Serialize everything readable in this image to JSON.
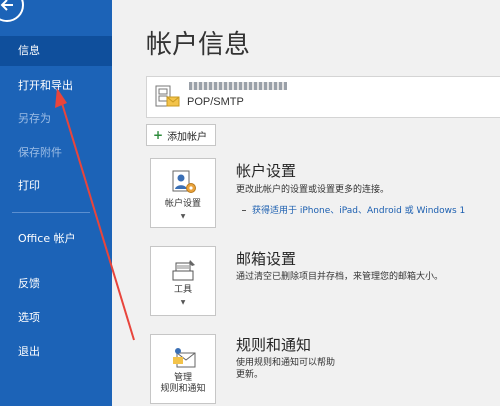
{
  "sidebar": {
    "items": [
      {
        "label": "信息",
        "state": "selected"
      },
      {
        "label": "打开和导出",
        "state": "normal"
      },
      {
        "label": "另存为",
        "state": "disabled"
      },
      {
        "label": "保存附件",
        "state": "disabled"
      },
      {
        "label": "打印",
        "state": "normal"
      },
      {
        "label": "Office 帐户",
        "state": "normal"
      },
      {
        "label": "反馈",
        "state": "normal"
      },
      {
        "label": "选项",
        "state": "normal"
      },
      {
        "label": "退出",
        "state": "normal"
      }
    ]
  },
  "main": {
    "title": "帐户信息",
    "account": {
      "type": "POP/SMTP"
    },
    "add_account_label": "添加帐户",
    "sections": [
      {
        "button_label": "帐户设置",
        "title": "帐户设置",
        "desc": "更改此帐户的设置或设置更多的连接。",
        "link": "获得适用于 iPhone、iPad、Android 或 Windows 1"
      },
      {
        "button_label": "工具",
        "title": "邮箱设置",
        "desc": "通过清空已删除项目并存档，来管理您的邮箱大小。"
      },
      {
        "button_label": "管理\n规则和通知",
        "title": "规则和通知",
        "desc": "使用规则和通知可以帮助\n更新。"
      }
    ]
  },
  "colors": {
    "sidebar": "#1c63b7",
    "sidebar_selected": "#0f4f9c",
    "annotation_arrow": "#e8453c"
  }
}
